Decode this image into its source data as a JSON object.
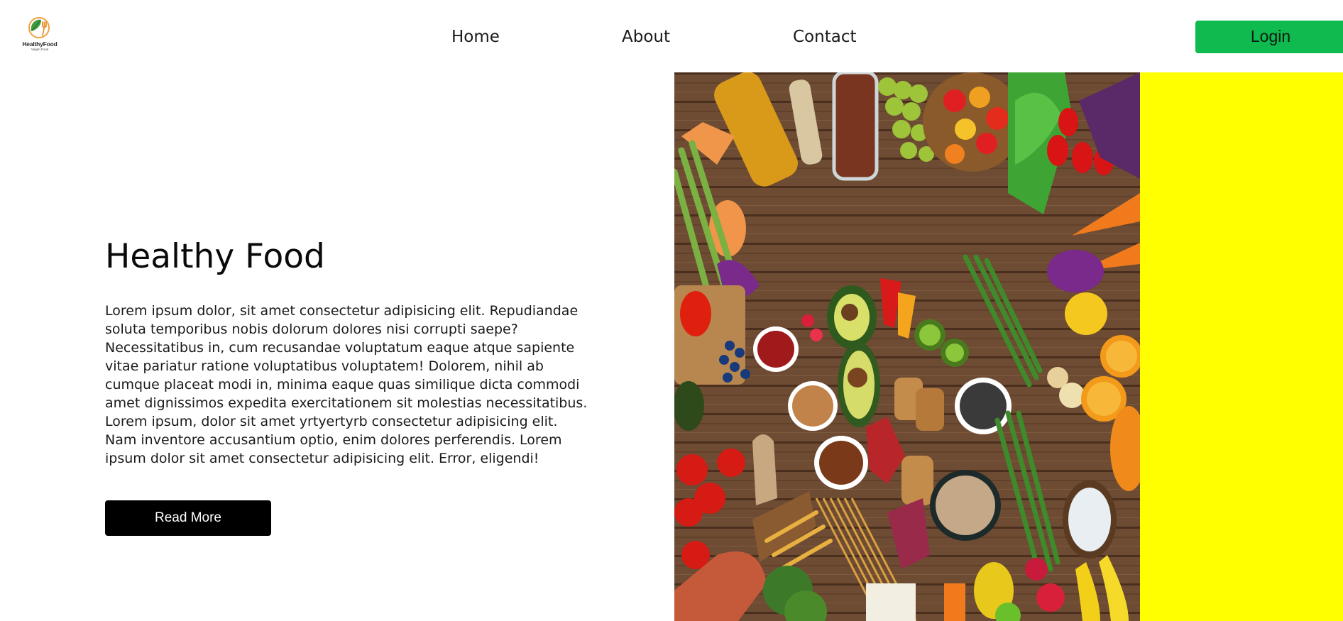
{
  "logo": {
    "name": "HealthyFood",
    "tagline": "Vegan Food",
    "icon": "leaf-fork-icon"
  },
  "nav": {
    "items": [
      {
        "label": "Home"
      },
      {
        "label": "About"
      },
      {
        "label": "Contact"
      }
    ],
    "login_label": "Login"
  },
  "hero": {
    "title": "Healthy Food",
    "body": "Lorem ipsum dolor, sit amet consectetur adipisicing elit. Repudiandae soluta temporibus nobis dolorum dolores nisi corrupti saepe? Necessitatibus in, cum recusandae voluptatum eaque atque sapiente vitae pariatur ratione voluptatibus voluptatem! Dolorem, nihil ab cumque placeat modi in, minima eaque quas similique dicta commodi amet dignissimos expedita exercitationem sit molestias necessitatibus. Lorem ipsum, dolor sit amet yrtyertyrb consectetur adipisicing elit. Nam inventore accusantium optio, enim dolores perferendis. Lorem ipsum dolor sit amet consectetur adipisicing elit. Error, eligendi!",
    "button_label": "Read More"
  },
  "colors": {
    "login_button": "#0fba4f",
    "read_more_button": "#000000",
    "side_panel": "#ffff00",
    "background": "#ffffff"
  }
}
